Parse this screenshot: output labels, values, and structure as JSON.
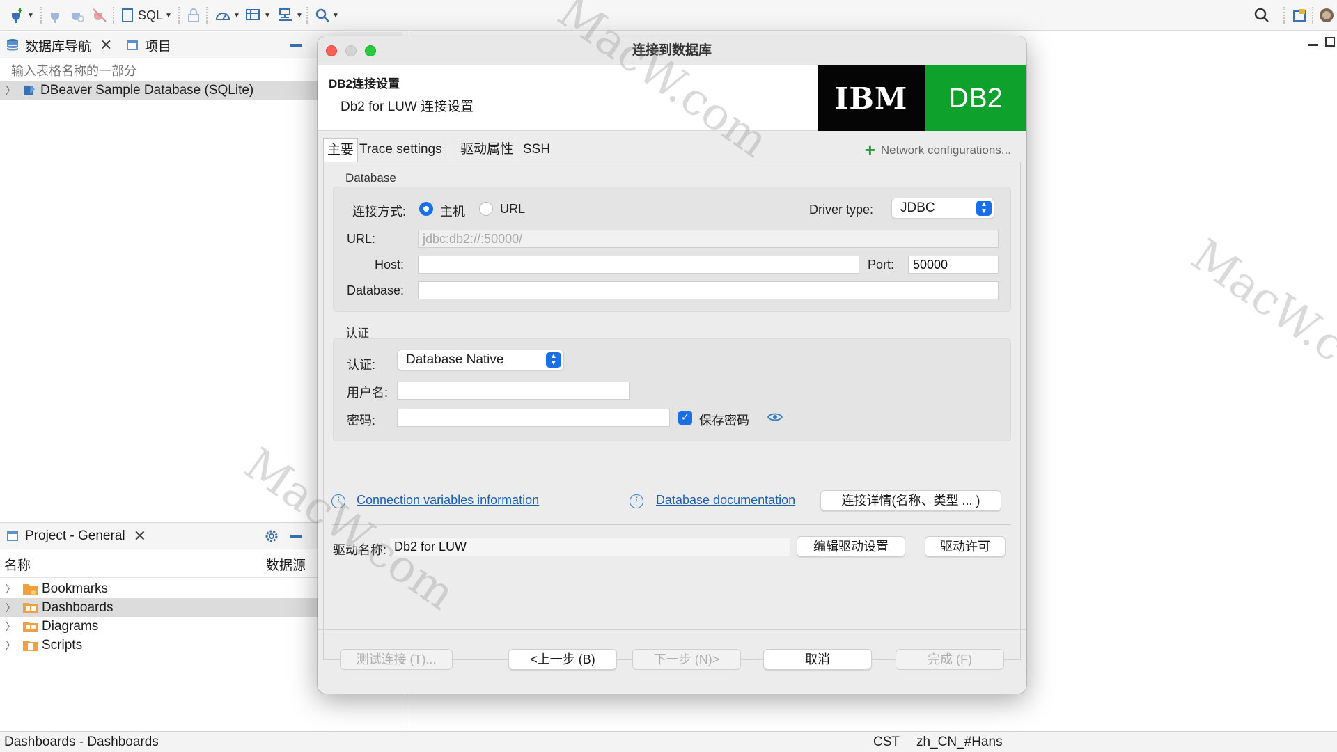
{
  "toolbar": {
    "sql_label": "SQL"
  },
  "nav": {
    "tab_navigator": "数据库导航",
    "tab_projects": "项目",
    "filter_placeholder": "输入表格名称的一部分",
    "tree": [
      {
        "label": "DBeaver Sample Database (SQLite)"
      }
    ]
  },
  "project": {
    "tab_label": "Project - General",
    "col_name": "名称",
    "col_datasource": "数据源",
    "items": [
      {
        "label": "Bookmarks"
      },
      {
        "label": "Dashboards"
      },
      {
        "label": "Diagrams"
      },
      {
        "label": "Scripts"
      }
    ]
  },
  "status": {
    "left": "Dashboards - Dashboards",
    "timezone": "CST",
    "locale": "zh_CN_#Hans"
  },
  "dialog": {
    "title": "连接到数据库",
    "header_title": "DB2连接设置",
    "header_subtitle": "Db2 for LUW 连接设置",
    "logo_ibm": "IBM",
    "logo_db2": "DB2",
    "tabs": [
      "主要",
      "Trace settings",
      "驱动属性",
      "SSH"
    ],
    "network_config": "Network configurations...",
    "database_group": "Database",
    "connect_mode_label": "连接方式:",
    "mode_host": "主机",
    "mode_url": "URL",
    "driver_type_label": "Driver type:",
    "driver_type_value": "JDBC",
    "url_label": "URL:",
    "url_value": "jdbc:db2://:50000/",
    "host_label": "Host:",
    "host_value": "",
    "port_label": "Port:",
    "port_value": "50000",
    "database_label": "Database:",
    "database_value": "",
    "auth_group": "认证",
    "auth_label": "认证:",
    "auth_value": "Database Native",
    "username_label": "用户名:",
    "username_value": "",
    "password_label": "密码:",
    "password_value": "",
    "save_password_label": "保存密码",
    "conn_vars_link": "Connection variables information",
    "db_doc_link": "Database documentation",
    "conn_details_btn": "连接详情(名称、类型 ... )",
    "driver_name_label": "驱动名称:",
    "driver_name_value": "Db2 for LUW",
    "edit_driver_btn": "编辑驱动设置",
    "driver_license_btn": "驱动许可",
    "btn_test": "测试连接 (T)...",
    "btn_back": "<上一步 (B)",
    "btn_next": "下一步 (N)>",
    "btn_cancel": "取消",
    "btn_finish": "完成 (F)"
  },
  "watermark": "MacW.com",
  "colors": {
    "accent": "#1a6fe8",
    "db2_green": "#0ea12b",
    "link": "#1d5fb3"
  }
}
